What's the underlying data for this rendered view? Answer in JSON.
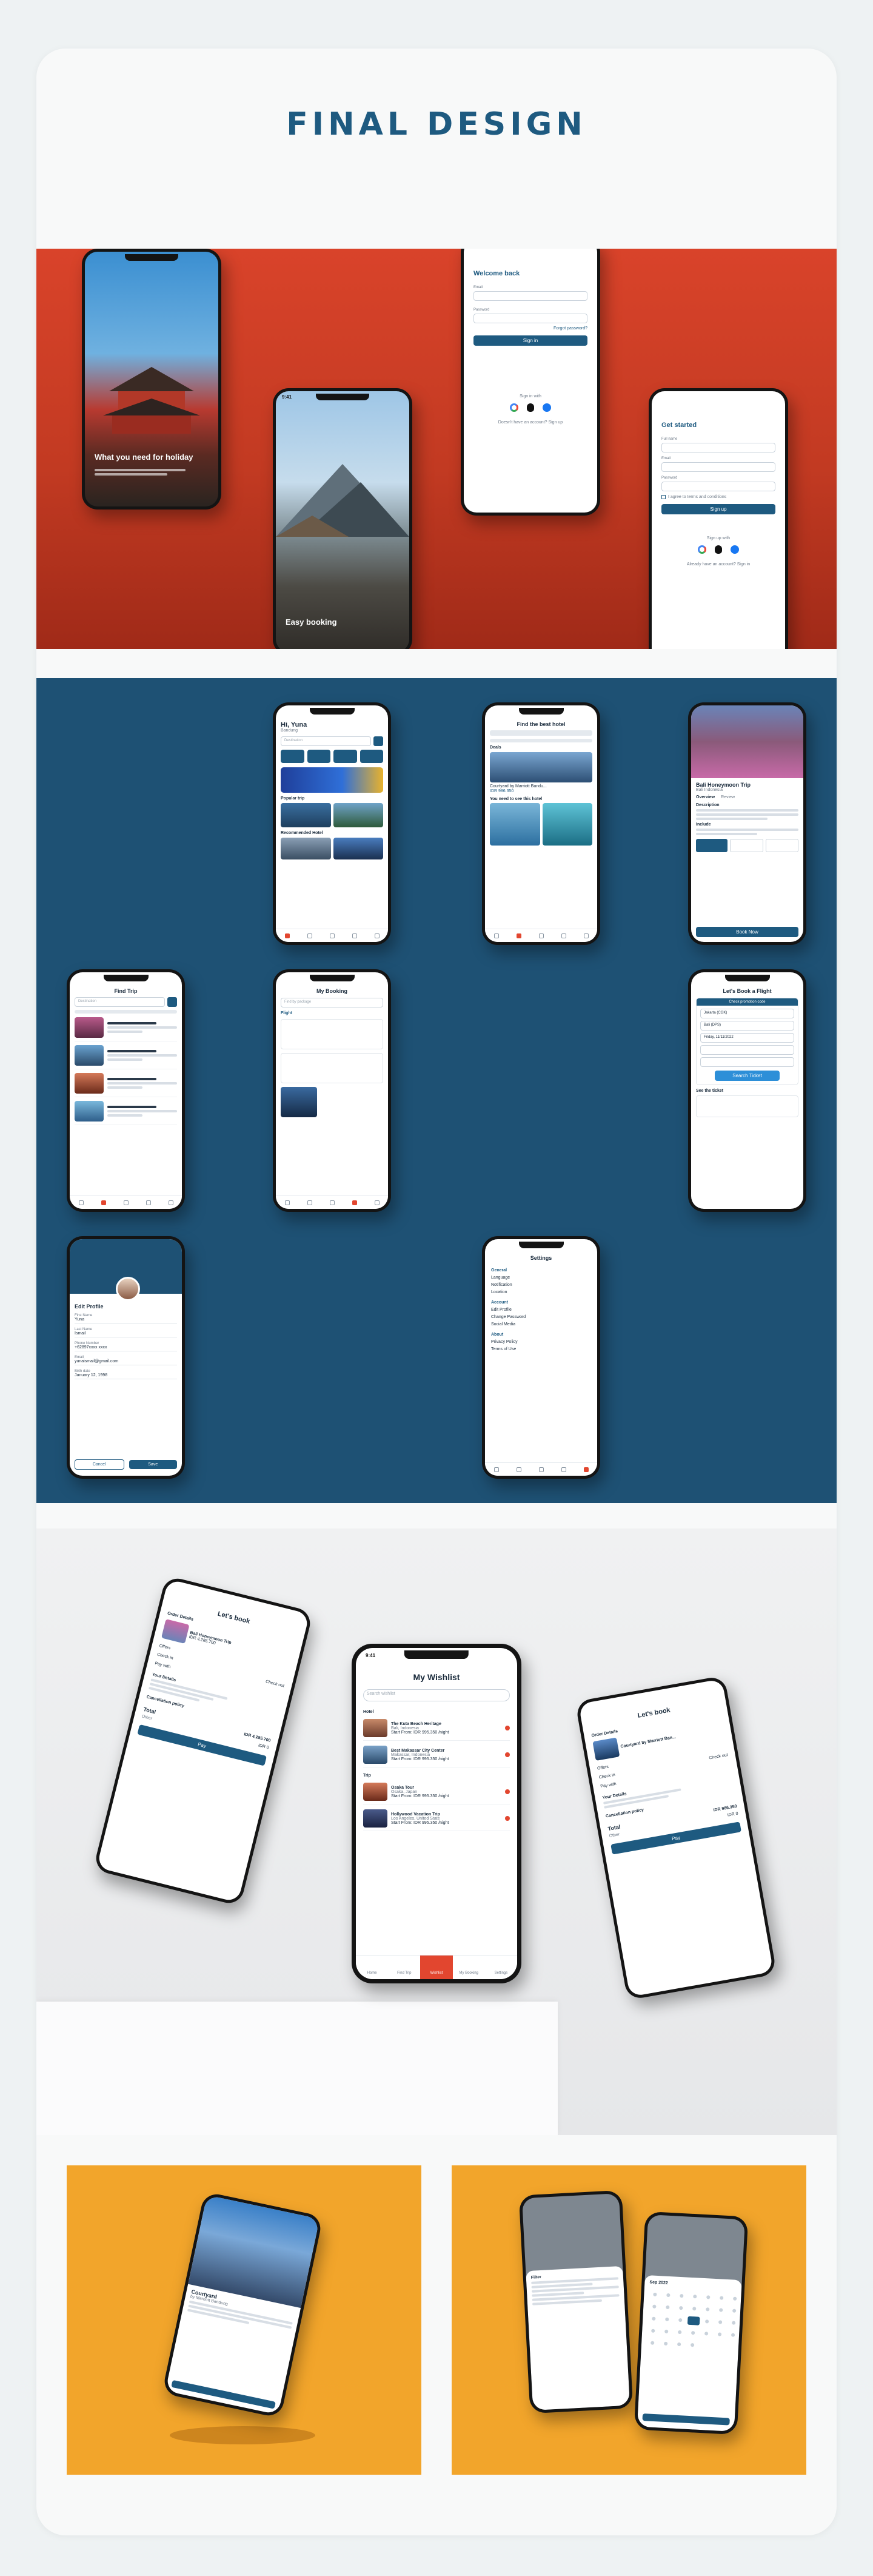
{
  "page": {
    "title": "FINAL DESIGN"
  },
  "onboarding": {
    "splash1_text": "What you need for holiday",
    "splash2_text": "Easy booking",
    "status_time": "9:41",
    "login": {
      "title": "Welcome back",
      "email_label": "Email",
      "password_label": "Password",
      "forgot": "Forgot password?",
      "button": "Sign in",
      "or": "Sign in with",
      "footer": "Doesn't have an account? Sign up"
    },
    "signup": {
      "title": "Get started",
      "name_label": "Full name",
      "email_label": "Email",
      "password_label": "Password",
      "agree": "I agree to terms and conditions",
      "button": "Sign up",
      "or": "Sign up with",
      "footer": "Already have an account? Sign in"
    }
  },
  "screens": {
    "home": {
      "greeting": "Hi, Yuna",
      "location": "Bandung",
      "search_placeholder": "Destination",
      "popular": "Popular trip",
      "recommended": "Recommended Hotel"
    },
    "hotel_search": {
      "title": "Find the best hotel",
      "deals": "Deals",
      "hotel_name": "Courtyard by Marriott Bandu...",
      "price": "IDR 986.350",
      "wishlist": "You need to see this hotel"
    },
    "detail": {
      "title": "Bali Honeymoon Trip",
      "location": "Bali Indonesia",
      "tab_overview": "Overview",
      "tab_review": "Review",
      "description": "Description",
      "include": "Include",
      "button": "Book Now"
    },
    "find_trip": {
      "title": "Find Trip",
      "search_placeholder": "Destination"
    },
    "my_booking": {
      "title": "My Booking",
      "tab_flight": "Flight",
      "search_placeholder": "Find by package"
    },
    "flight": {
      "title": "Let's Book a Flight",
      "tab": "Check promotion code",
      "from": "Jakarta (CGK)",
      "to": "Bali (DPS)",
      "date": "Friday, 11/11/2022",
      "button": "Search Ticket",
      "see_all": "See the ticket"
    },
    "edit_profile": {
      "title": "Edit Profile",
      "first_name_label": "First Name",
      "first_name": "Yuna",
      "last_name_label": "Last Name",
      "last_name": "Ismail",
      "phone_label": "Phone Number",
      "phone": "+62897xxxx xxxx",
      "email_label": "Email",
      "email": "yunaismail@gmail.com",
      "birth_label": "Birth date",
      "birth": "January 12, 1998",
      "cancel": "Cancel",
      "save": "Save"
    },
    "settings": {
      "title": "Settings",
      "general": "General",
      "items_general": [
        "Language",
        "Notification",
        "Location"
      ],
      "account": "Account",
      "items_account": [
        "Edit Profile",
        "Change Password",
        "Social Media"
      ],
      "about": "About",
      "items_about": [
        "Privacy Policy",
        "Terms of Use"
      ]
    }
  },
  "wishlist": {
    "title": "My Wishlist",
    "search_placeholder": "Search wishlist",
    "section_hotel": "Hotel",
    "section_trip": "Trip",
    "items": [
      {
        "name": "The Kuta Beach Heritage",
        "place": "Bali, Indonesia",
        "price": "Start From: IDR 995.350 /night"
      },
      {
        "name": "Best Makassar City Center",
        "place": "Makassar, Indonesia",
        "price": "Start From: IDR 995.350 /night"
      },
      {
        "name": "Osaka Tour",
        "place": "Osaka, Japan",
        "price": "Start From: IDR 995.350 /night"
      },
      {
        "name": "Hollywood Vacation Trip",
        "place": "Los Angeles, United State",
        "price": "Start From: IDR 995.350 /night"
      }
    ],
    "nav": [
      "Home",
      "Find Trip",
      "Wishlist",
      "My Booking",
      "Settings"
    ]
  },
  "booking": {
    "title": "Let's book",
    "order": "Order Details",
    "hotel": "Bali Honeymoon Trip",
    "price": "IDR 4.285.700",
    "offers": "Offers",
    "checkin": "Check in",
    "checkout": "Check out",
    "payment": "Pay with",
    "your_details": "Your Details",
    "cancellation": "Cancellation policy",
    "total": "Total",
    "total_value": "IDR 4.285.700",
    "other": "Other",
    "other_value": "IDR 0",
    "pay": "Pay",
    "right_hotel": "Courtyard by Marriott Ban...",
    "right_total": "IDR 986.350"
  },
  "promo": {
    "hotel_name": "Courtyard",
    "hotel_sub": "by Marriott Bandung",
    "calendar_month": "Sep 2022",
    "filter": "Filter"
  },
  "colors": {
    "primary": "#1e5a80",
    "accent": "#e2462f",
    "orange": "#f2a52b"
  }
}
